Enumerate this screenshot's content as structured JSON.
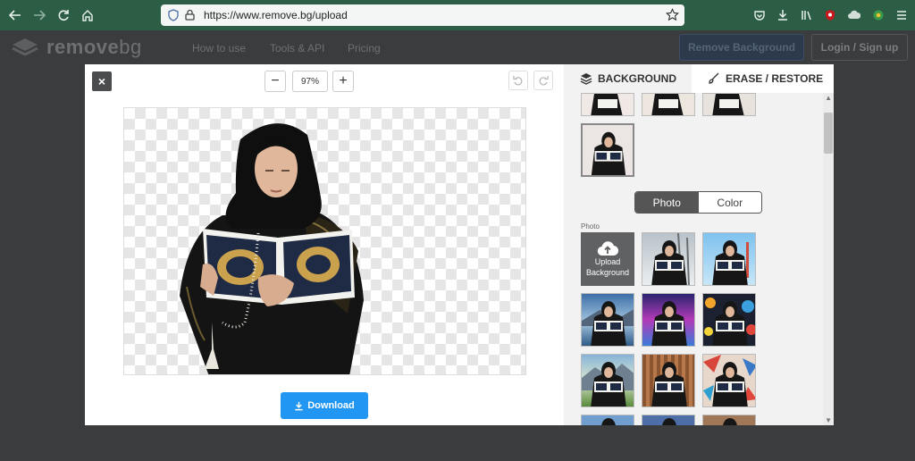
{
  "browser": {
    "url": "https://www.remove.bg/upload",
    "colors": {
      "chrome": "#2b5e44"
    }
  },
  "site": {
    "logo_main": "remove",
    "logo_suffix": "bg",
    "nav": [
      "How to use",
      "Tools & API",
      "Pricing"
    ],
    "remove_bg_button": "Remove Background",
    "login_button": "Login / Sign up"
  },
  "editor": {
    "close_label": "×",
    "zoom_out_label": "−",
    "zoom_value": "97%",
    "zoom_in_label": "+",
    "undo_icon": "undo-icon",
    "redo_icon": "redo-icon",
    "download_label": "Download",
    "accent_color": "#2196f3"
  },
  "panel": {
    "tabs": [
      {
        "label": "BACKGROUND",
        "icon": "layers-icon"
      },
      {
        "label": "ERASE / RESTORE",
        "icon": "brush-icon"
      }
    ],
    "toggle": {
      "photo": "Photo",
      "color": "Color",
      "selected": "Photo"
    },
    "section_label": "Photo",
    "upload_tile": {
      "line1": "Upload",
      "line2": "Background",
      "icon": "cloud-upload-icon"
    }
  }
}
